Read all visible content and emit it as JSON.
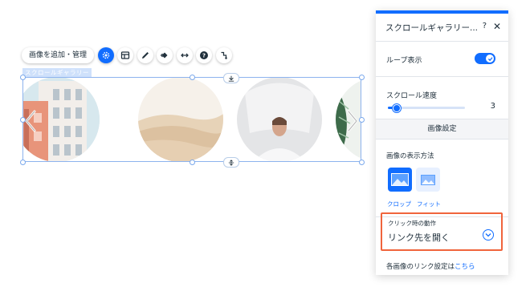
{
  "toolbar": {
    "add_manage_label": "画像を追加・管理",
    "icons": [
      "gear-icon",
      "layout-icon",
      "design-icon",
      "animation-icon",
      "stretch-icon",
      "help-icon",
      "connect-icon"
    ]
  },
  "gallery": {
    "selection_label": "スクロールギャラリー",
    "images": [
      "building",
      "desert-dunes",
      "woman-white-cloth",
      "leaf-plant"
    ]
  },
  "panel": {
    "title": "スクロールギャラリー...",
    "help": "?",
    "close": "✕",
    "loop_label": "ループ表示",
    "loop_enabled": true,
    "speed_label": "スクロール速度",
    "speed_value": "3",
    "speed_fraction": 0.1,
    "section_image_settings": "画像設定",
    "display_method_label": "画像の表示方法",
    "display_options": [
      {
        "label": "クロップ",
        "selected": true
      },
      {
        "label": "フィット",
        "selected": false
      }
    ],
    "click_action_label": "クリック時の動作",
    "click_action_value": "リンク先を開く",
    "link_setting_text": "各画像のリンク設定は",
    "link_setting_link": "こちら"
  },
  "colors": {
    "accent": "#116dff",
    "highlight": "#f0643c"
  }
}
